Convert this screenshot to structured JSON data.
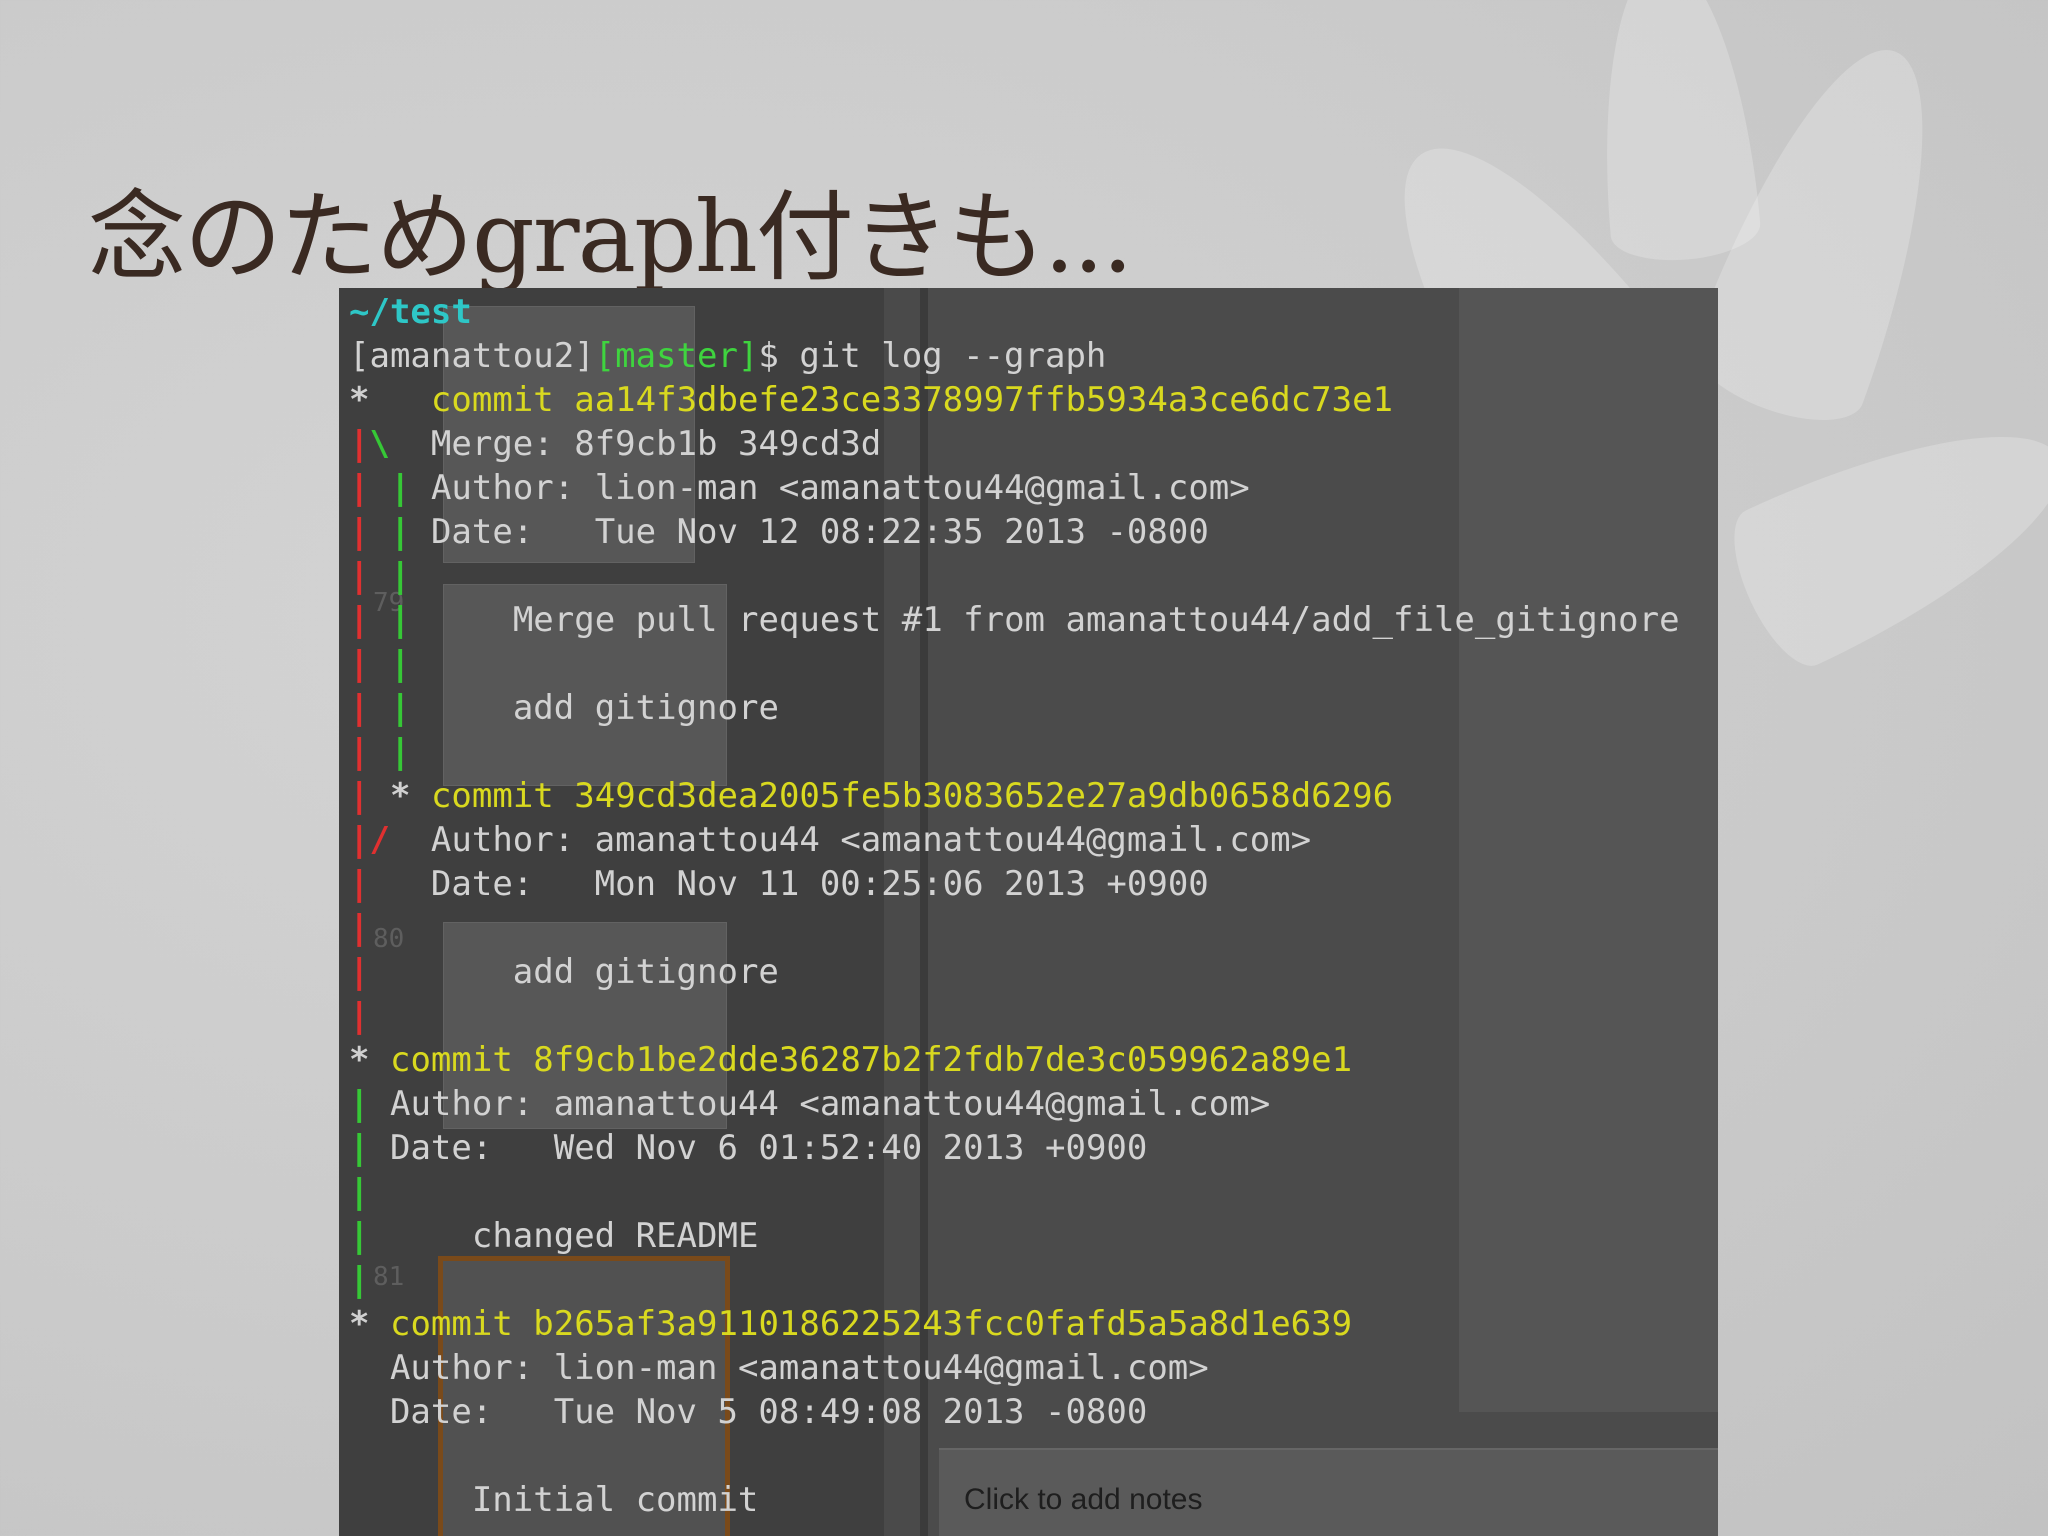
{
  "slide": {
    "title": "念のためgraph付きも..."
  },
  "terminal": {
    "path": "~/test",
    "prompt_user": "[amanattou2]",
    "prompt_branch": "[master]",
    "prompt_symbol": "$ ",
    "command": "git log --graph",
    "commits": [
      {
        "keyword": "commit",
        "hash": "aa14f3dbefe23ce3378997ffb5934a3ce6dc73e1",
        "merge": "Merge: 8f9cb1b 349cd3d",
        "author": "Author: lion-man <amanattou44@gmail.com>",
        "date": "Date:   Tue Nov 12 08:22:35 2013 -0800",
        "messages": [
          "Merge pull request #1 from amanattou44/add_file_gitignore",
          "add gitignore"
        ]
      },
      {
        "keyword": "commit",
        "hash": "349cd3dea2005fe5b3083652e27a9db0658d6296",
        "author": "Author: amanattou44 <amanattou44@gmail.com>",
        "date": "Date:   Mon Nov 11 00:25:06 2013 +0900",
        "messages": [
          "add gitignore"
        ]
      },
      {
        "keyword": "commit",
        "hash": "8f9cb1be2dde36287b2f2fdb7de3c059962a89e1",
        "author": "Author: amanattou44 <amanattou44@gmail.com>",
        "date": "Date:   Wed Nov 6 01:52:40 2013 +0900",
        "messages": [
          "changed README"
        ]
      },
      {
        "keyword": "commit",
        "hash": "b265af3a9110186225243fcc0fafd5a5a8d1e639",
        "author": "Author: lion-man <amanattou44@gmail.com>",
        "date": "Date:   Tue Nov 5 08:49:08 2013 -0800",
        "messages": [
          "Initial commit"
        ]
      }
    ],
    "graph": {
      "star": "*",
      "pipe": "|",
      "backslash": "\\",
      "slash": "/"
    }
  },
  "background_app": {
    "notes_placeholder": "Click to add notes",
    "slide_numbers": [
      "79",
      "80",
      "81"
    ]
  },
  "colors": {
    "path": "#2ec7c7",
    "branch": "#3fd43f",
    "commit": "#d9d91f",
    "graph_left": "#e03030",
    "graph_right": "#36c836"
  }
}
